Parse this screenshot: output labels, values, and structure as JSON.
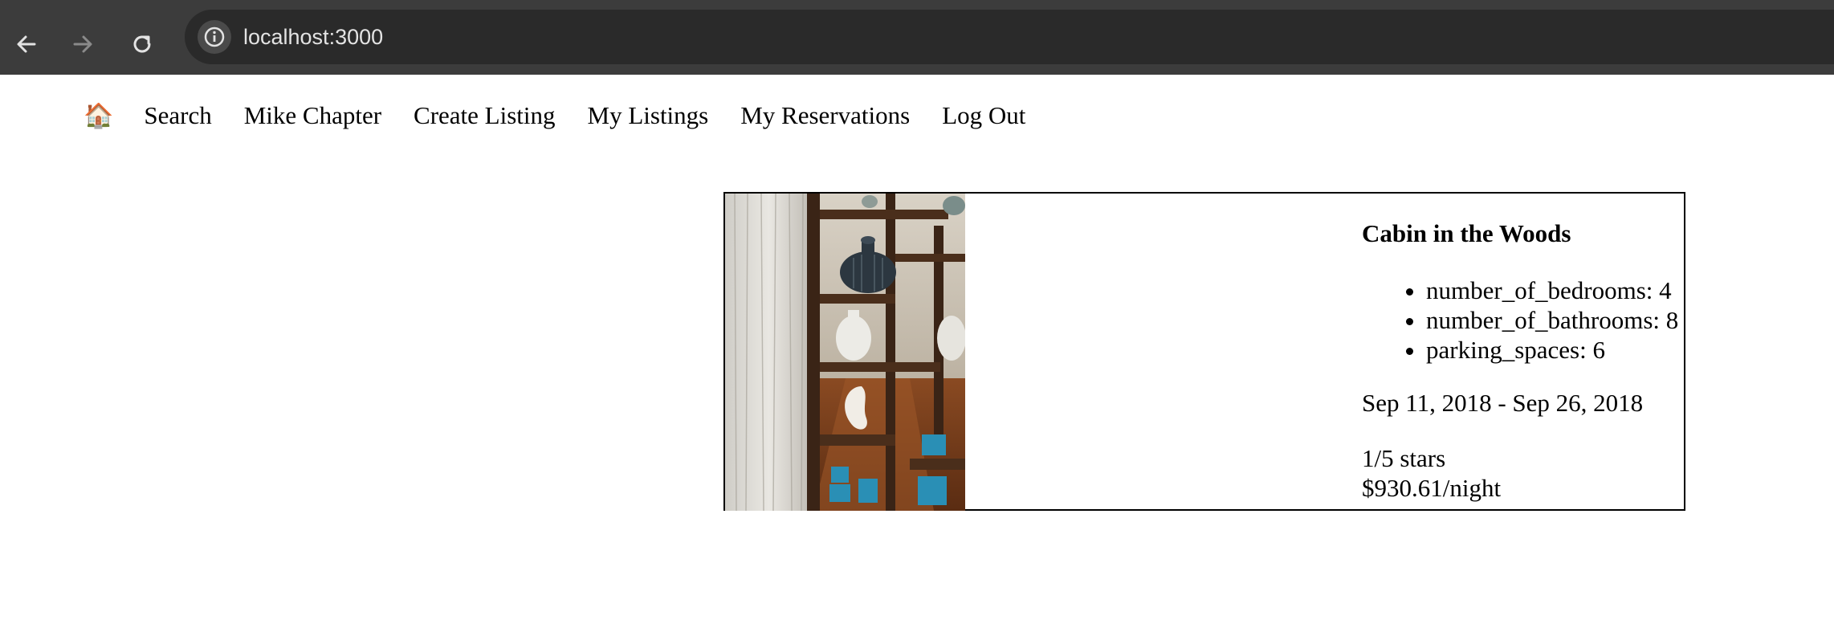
{
  "browser": {
    "url": "localhost:3000",
    "icons": {
      "back": "back-arrow-icon",
      "forward": "forward-arrow-icon",
      "reload": "reload-icon",
      "site_info": "info-icon"
    }
  },
  "nav": {
    "home_icon": "🏠",
    "items": [
      {
        "label": "Search"
      },
      {
        "label": "Mike Chapter"
      },
      {
        "label": "Create Listing"
      },
      {
        "label": "My Listings"
      },
      {
        "label": "My Reservations"
      },
      {
        "label": "Log Out"
      }
    ]
  },
  "listing": {
    "title": "Cabin in the Woods",
    "features": [
      "number_of_bedrooms: 4",
      "number_of_bathrooms: 8",
      "parking_spaces: 6"
    ],
    "dates": "Sep 11, 2018 - Sep 26, 2018",
    "rating": "1/5 stars",
    "price": "$930.61/night"
  }
}
